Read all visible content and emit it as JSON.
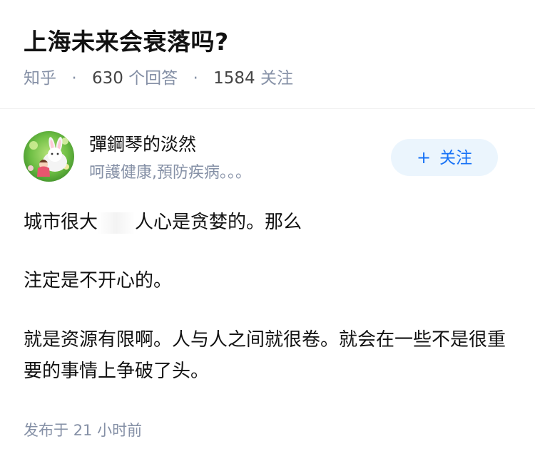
{
  "question": {
    "title": "上海未来会衰落吗?",
    "source": "知乎",
    "answers_count": "630",
    "answers_label": "个回答",
    "followers_count": "1584",
    "followers_label": "关注"
  },
  "author": {
    "name": "彈鋼琴的淡然",
    "bio": "呵護健康,預防疾病。。。",
    "follow_label": "关注",
    "follow_icon": "plus-icon"
  },
  "answer": {
    "p1_before": "城市很大",
    "p1_after": "人心是贪婪的。那么",
    "p2": "注定是不开心的。",
    "p3": "就是资源有限啊。人与人之间就很卷。就会在一些不是很重要的事情上争破了头。"
  },
  "publish": {
    "label": "发布于",
    "time": "21 小时前"
  },
  "colors": {
    "accent": "#1772f6",
    "follow_bg": "#ebf5fd",
    "meta": "#8590a6"
  }
}
